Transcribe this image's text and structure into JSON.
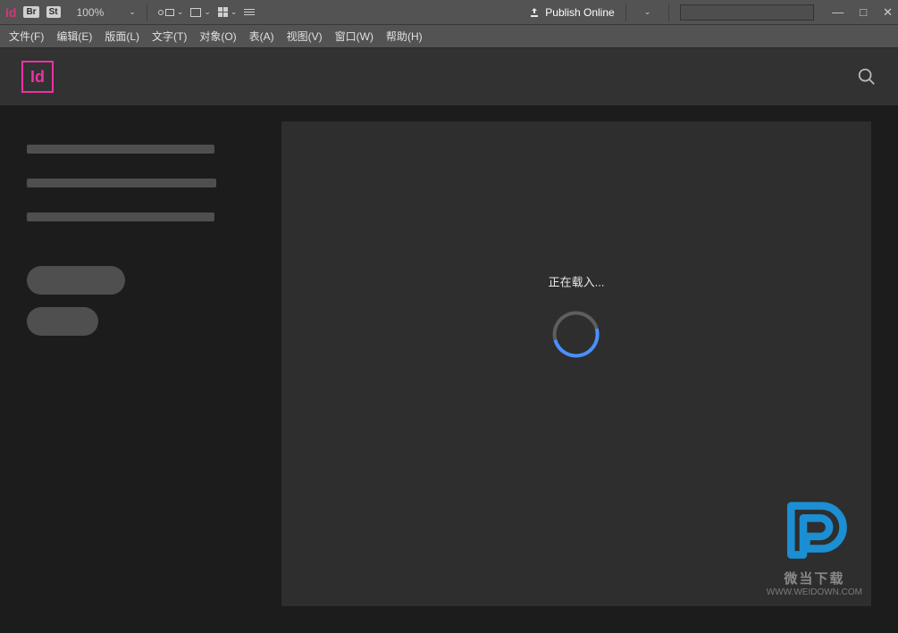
{
  "app": {
    "logo_text": "Id",
    "br_badge": "Br",
    "st_badge": "St"
  },
  "toolbar": {
    "zoom": "100%",
    "publish_label": "Publish Online"
  },
  "menus": [
    "文件(F)",
    "编辑(E)",
    "版面(L)",
    "文字(T)",
    "对象(O)",
    "表(A)",
    "视图(V)",
    "窗口(W)",
    "帮助(H)"
  ],
  "brand": {
    "box_text": "Id"
  },
  "loading": {
    "text": "正在载入..."
  },
  "watermark": {
    "line1": "微当下载",
    "line2": "WWW.WEIDOWN.COM"
  }
}
